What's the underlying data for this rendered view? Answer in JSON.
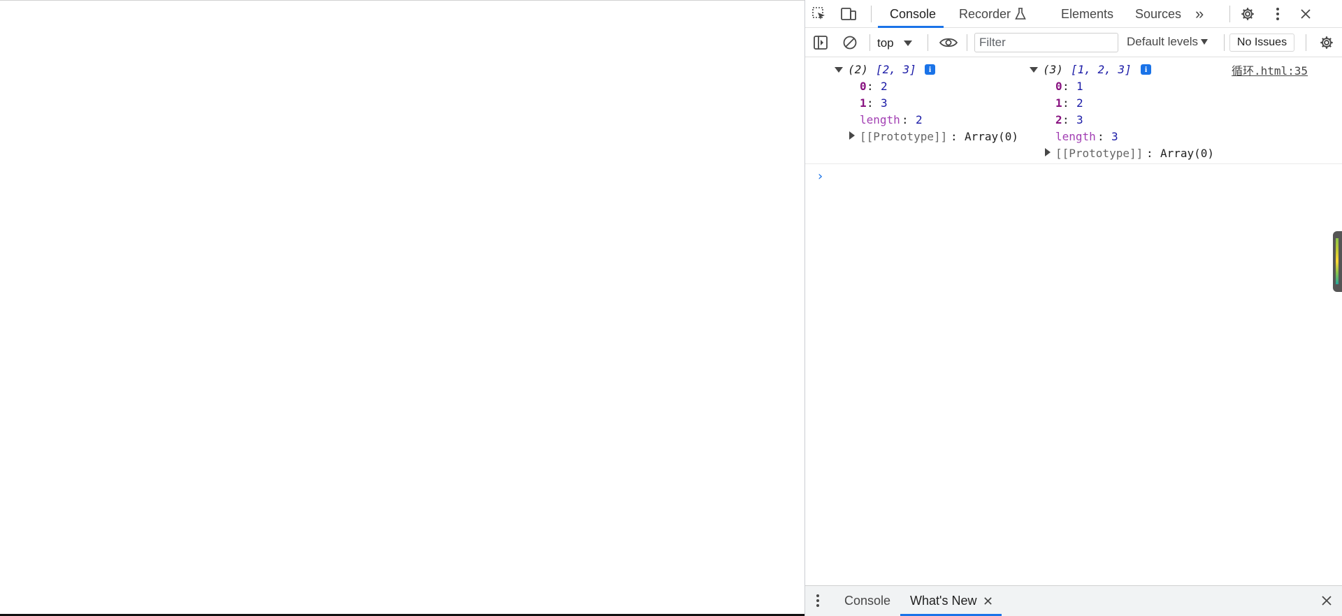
{
  "devtools": {
    "main_tabs": [
      {
        "label": "Console",
        "active": true
      },
      {
        "label": "Recorder",
        "active": false
      },
      {
        "label": "Elements",
        "active": false
      },
      {
        "label": "Sources",
        "active": false
      }
    ],
    "more_tabs_glyph": "»",
    "icons": {
      "inspect": "inspect-element-icon",
      "device": "device-toolbar-icon",
      "settings": "settings-gear-icon",
      "menu": "kebab-menu-icon",
      "close": "close-icon"
    }
  },
  "console_toolbar": {
    "context": "top",
    "filter_placeholder": "Filter",
    "filter_value": "",
    "levels_label": "Default levels",
    "issues_label": "No Issues"
  },
  "log_entry": {
    "source_link": "循环.html:35",
    "arrays": [
      {
        "summary_count": "(2)",
        "summary_values": "[2, 3]",
        "items": [
          {
            "key": "0",
            "value": "2"
          },
          {
            "key": "1",
            "value": "3"
          }
        ],
        "length_label": "length",
        "length_value": "2",
        "prototype_label": "[[Prototype]]",
        "prototype_value": "Array(0)"
      },
      {
        "summary_count": "(3)",
        "summary_values": "[1, 2, 3]",
        "items": [
          {
            "key": "0",
            "value": "1"
          },
          {
            "key": "1",
            "value": "2"
          },
          {
            "key": "2",
            "value": "3"
          }
        ],
        "length_label": "length",
        "length_value": "3",
        "prototype_label": "[[Prototype]]",
        "prototype_value": "Array(0)"
      }
    ]
  },
  "drawer": {
    "tabs": [
      {
        "label": "Console",
        "active": false
      },
      {
        "label": "What's New",
        "active": true
      }
    ]
  },
  "colors": {
    "accent": "#1a73e8",
    "number": "#1a1aa6",
    "key": "#881280"
  }
}
